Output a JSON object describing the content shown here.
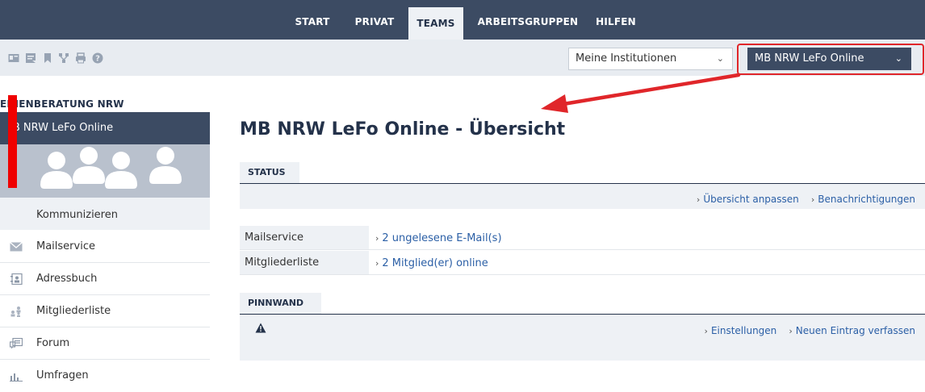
{
  "topnav": {
    "tabs": [
      {
        "label": "START",
        "active": false
      },
      {
        "label": "PRIVAT",
        "active": false
      },
      {
        "label": "TEAMS",
        "active": true
      },
      {
        "label": "ARBEITSGRUPPEN",
        "active": false
      },
      {
        "label": "HILFEN",
        "active": false
      }
    ]
  },
  "toolbar": {
    "icons": [
      "card-icon",
      "note-icon",
      "bookmark-icon",
      "network-icon",
      "print-icon",
      "help-icon"
    ],
    "institution_select": "Meine Institutionen",
    "team_select": "MB NRW LeFo Online"
  },
  "sidebar": {
    "org": "EDIENBERATUNG NRW",
    "team": "IB NRW LeFo Online",
    "section": "Kommunizieren",
    "items": [
      {
        "label": "Mailservice",
        "icon": "mail-icon"
      },
      {
        "label": "Adressbuch",
        "icon": "address-book-icon"
      },
      {
        "label": "Mitgliederliste",
        "icon": "members-icon"
      },
      {
        "label": "Forum",
        "icon": "forum-icon"
      },
      {
        "label": "Umfragen",
        "icon": "survey-icon"
      }
    ]
  },
  "main": {
    "title": "MB NRW LeFo Online - Übersicht",
    "status": {
      "tab": "STATUS",
      "links": [
        "Übersicht anpassen",
        "Benachrichtigungen"
      ]
    },
    "rows": [
      {
        "label": "Mailservice",
        "value": "2 ungelesene E-Mail(s)"
      },
      {
        "label": "Mitgliederliste",
        "value": "2 Mitglied(er) online"
      }
    ],
    "pinnwand": {
      "tab": "PINNWAND",
      "links": [
        "Einstellungen",
        "Neuen Eintrag verfassen"
      ]
    }
  },
  "colors": {
    "nav_bg": "#3c4b63",
    "light_panel": "#eef1f5",
    "link": "#2b5fa6",
    "annotation_red": "#e0262a"
  }
}
